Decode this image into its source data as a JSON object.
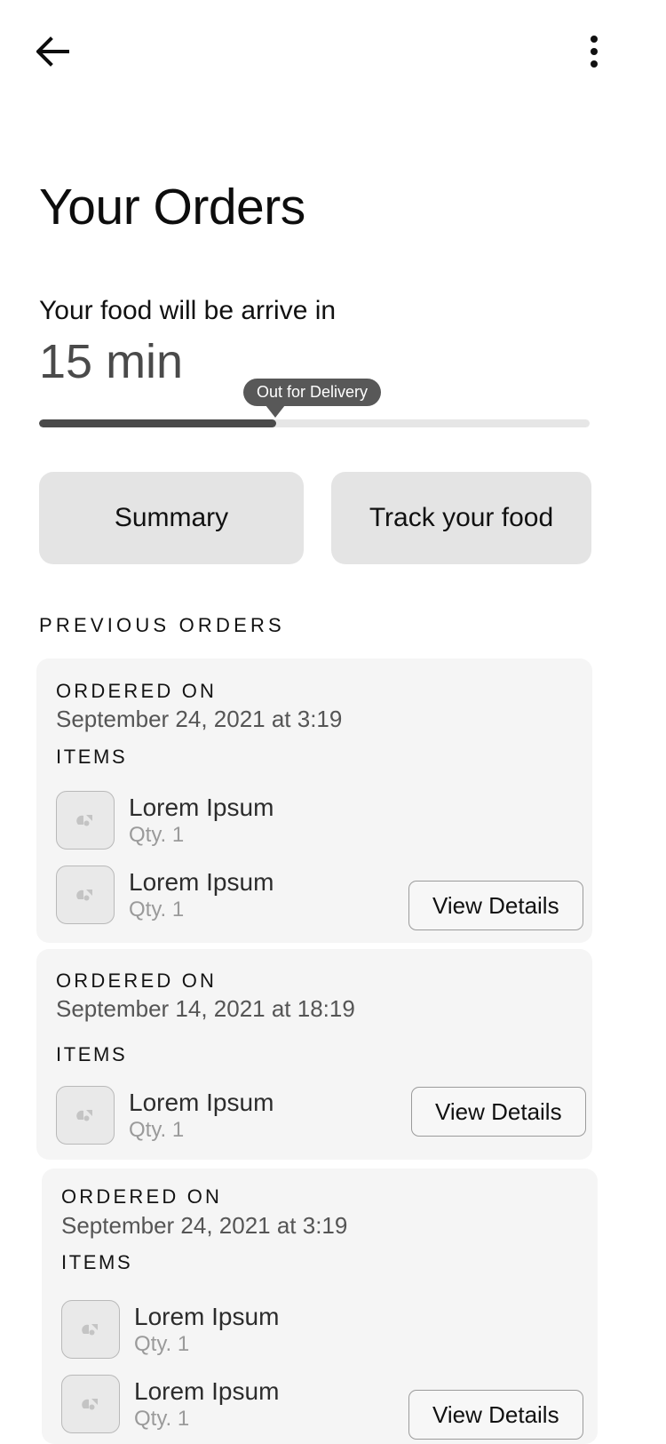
{
  "appbar": {
    "back_icon": "arrow-left-icon",
    "overflow_icon": "more-vertical-icon"
  },
  "header": {
    "title": "Your Orders"
  },
  "delivery": {
    "eta_label": "Your food will be arrive in",
    "eta_value": "15 min",
    "status_tooltip": "Out for Delivery",
    "progress_percent": 43,
    "progress_fill_color": "#4a4a4a",
    "progress_track_color": "#e6e6e6"
  },
  "actions": {
    "summary_label": "Summary",
    "track_label": "Track your food"
  },
  "previous_orders": {
    "section_label": "PREVIOUS ORDERS",
    "ordered_on_label": "ORDERED ON",
    "items_label": "ITEMS",
    "view_details_label": "View Details",
    "cards": [
      {
        "date": "September 24, 2021 at 3:19",
        "items": [
          {
            "name": "Lorem Ipsum",
            "qty": "Qty. 1"
          },
          {
            "name": "Lorem Ipsum",
            "qty": "Qty. 1"
          }
        ]
      },
      {
        "date": "September 14, 2021 at 18:19",
        "items": [
          {
            "name": "Lorem Ipsum",
            "qty": "Qty. 1"
          }
        ]
      },
      {
        "date": "September 24, 2021 at 3:19",
        "items": [
          {
            "name": "Lorem Ipsum",
            "qty": "Qty. 1"
          },
          {
            "name": "Lorem Ipsum",
            "qty": "Qty. 1"
          }
        ]
      }
    ]
  },
  "colors": {
    "card_background": "#f5f5f5",
    "button_background": "#e4e4e4",
    "tooltip_background": "#585858"
  }
}
